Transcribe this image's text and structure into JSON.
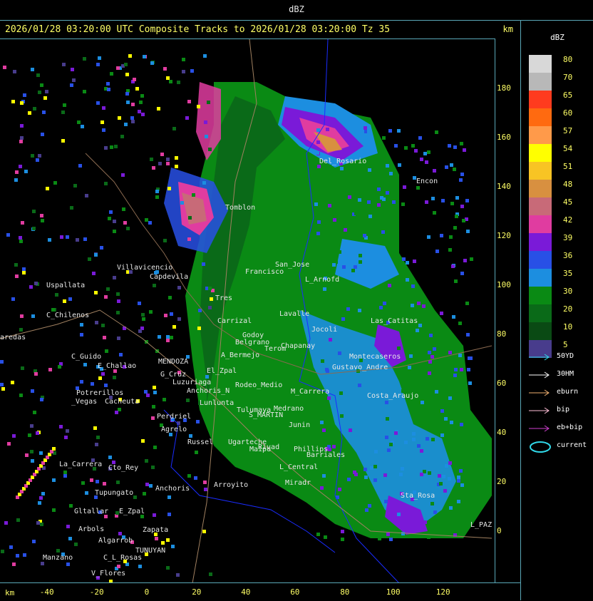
{
  "window": {
    "title": "dBZ"
  },
  "header": {
    "title": "2026/01/28 03:20:00 UTC Composite Tracks to 2026/01/28 03:20:00 Tz 35",
    "km_label": "km"
  },
  "axes": {
    "y_ticks": [
      "180",
      "160",
      "140",
      "120",
      "100",
      "80",
      "60",
      "40",
      "20",
      "0"
    ],
    "x_ticks": [
      "-40",
      "-20",
      "0",
      "20",
      "40",
      "60",
      "80",
      "100",
      "120"
    ],
    "x_unit": "km"
  },
  "legend": {
    "unit": "dBZ",
    "scale": [
      {
        "label": "80",
        "color": "#d8d8d8"
      },
      {
        "label": "70",
        "color": "#b8b8b8"
      },
      {
        "label": "65",
        "color": "#ff3b1e"
      },
      {
        "label": "60",
        "color": "#ff6a10"
      },
      {
        "label": "57",
        "color": "#ff9a4a"
      },
      {
        "label": "54",
        "color": "#ffff00"
      },
      {
        "label": "51",
        "color": "#f8c424"
      },
      {
        "label": "48",
        "color": "#d89040"
      },
      {
        "label": "45",
        "color": "#c86a78"
      },
      {
        "label": "42",
        "color": "#e03ca0"
      },
      {
        "label": "39",
        "color": "#7a1ad8"
      },
      {
        "label": "36",
        "color": "#2850e6"
      },
      {
        "label": "35",
        "color": "#1c8ee0"
      },
      {
        "label": "30",
        "color": "#0a8a14"
      },
      {
        "label": "20",
        "color": "#0a6a18"
      },
      {
        "label": "10",
        "color": "#0a4a14"
      },
      {
        "label": "5",
        "color": "#483c8c"
      }
    ],
    "tracks": [
      {
        "label": "50YD",
        "color": "#30d8e8"
      },
      {
        "label": "30HM",
        "color": "#ffffff"
      },
      {
        "label": "eburn",
        "color": "#f0b070"
      },
      {
        "label": "bip",
        "color": "#ffc0d8"
      },
      {
        "label": "eb+bip",
        "color": "#d040d0"
      }
    ],
    "current": {
      "label": "current",
      "color": "#30d8e8"
    }
  },
  "places": [
    "Uspallata",
    "C_Chilenos",
    "aredas",
    "C_Guido",
    "E_Challao",
    "Potrerillos",
    "_Vegas",
    "Cacheuta",
    "La_Carrera",
    "Cto_Rey",
    "Villavicencio",
    "Capdevila",
    "Tres",
    "San_Jose",
    "Francisco",
    "L_Arnofd",
    "Del_Rosario",
    "Encon",
    "Tomblon",
    "MENDOZA",
    "G_Cruz",
    "Luzuriaga",
    "Godoy",
    "Perdriel",
    "Agrelo",
    "S_MARTIN",
    "Phillips",
    "L_Central",
    "Miradr",
    "Tupungato",
    "Anchoris",
    "Gltallar",
    "E_Zpal",
    "Arbols",
    "Algarrob",
    "Zapata",
    "TUNUYAN",
    "C_L_Rosas",
    "V_Flores",
    "Manzano",
    "L_PAZ",
    "Maipu",
    "Rivad",
    "Junin",
    "Barriales",
    "M_Carrera",
    "Chapanay",
    "Terom",
    "Medrano",
    "Montecaseros",
    "Las_Catitas",
    "Sta_Rosa",
    "Ugarteche",
    "Carrizal",
    "El_Zpal",
    "Anchoris_N",
    "Arroyito",
    "Lunlunta",
    "Russel",
    "Rodeo_Medio",
    "A_Bermejo",
    "Belgrano",
    "Lavalle",
    "Costa_Araujo",
    "Jocoli",
    "Gustavo_Andre",
    "Tulumaya"
  ]
}
